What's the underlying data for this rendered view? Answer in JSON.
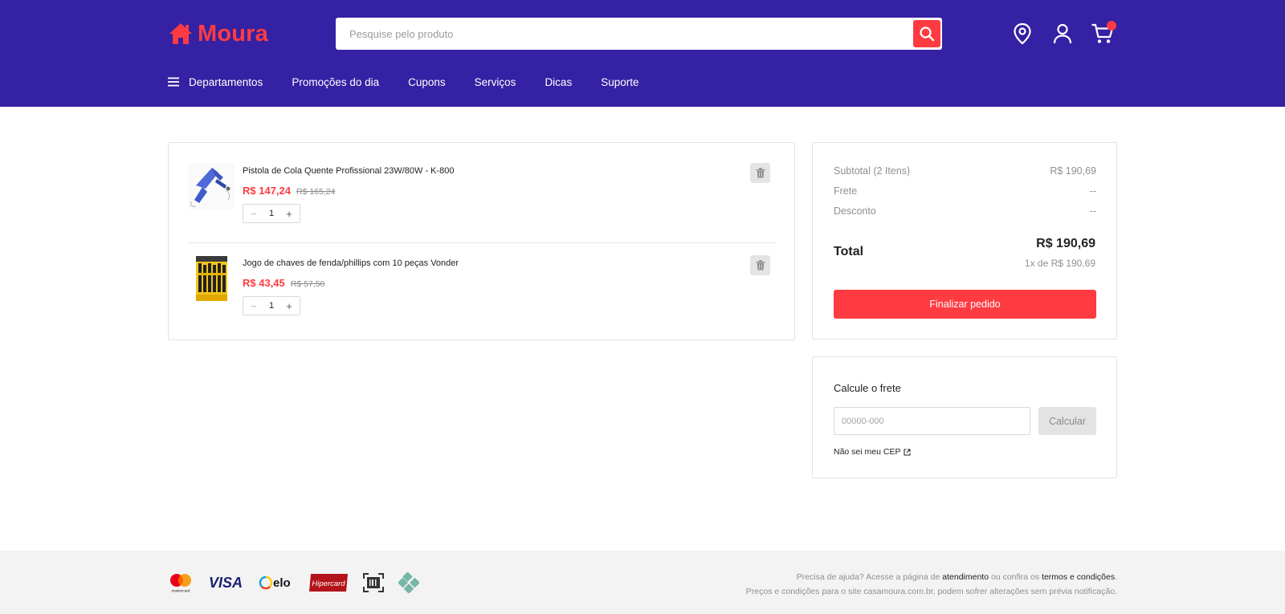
{
  "brand": {
    "name": "Moura",
    "accent": "#ff3b42",
    "header_bg": "#3421a3"
  },
  "search": {
    "placeholder": "Pesquise pelo produto"
  },
  "nav": {
    "departments": "Departamentos",
    "items": [
      "Promoções do dia",
      "Cupons",
      "Serviços",
      "Dicas",
      "Suporte"
    ]
  },
  "cart": {
    "items": [
      {
        "name": "Pistola de Cola Quente Profissional 23W/80W - K-800",
        "price": "R$ 147,24",
        "old_price": "R$ 165,24",
        "qty": "1",
        "icon": "glue-gun"
      },
      {
        "name": "Jogo de chaves de fenda/phillips com 10 peças Vonder",
        "price": "R$ 43,45",
        "old_price": "R$ 57,50",
        "qty": "1",
        "icon": "screwdriver-set"
      }
    ],
    "minus": "−",
    "plus": "+"
  },
  "summary": {
    "subtotal_label": "Subtotal (2 Itens)",
    "subtotal_value": "R$ 190,69",
    "shipping_label": "Frete",
    "shipping_value": "--",
    "discount_label": "Desconto",
    "discount_value": "--",
    "total_label": "Total",
    "total_value": "R$ 190,69",
    "installments": "1x de R$ 190,69",
    "checkout_label": "Finalizar pedido"
  },
  "shipping_calc": {
    "title": "Calcule o frete",
    "placeholder": "00000-000",
    "button": "Calcular",
    "link": "Não sei meu CEP"
  },
  "footer": {
    "payment_methods": [
      "mastercard",
      "VISA",
      "elo",
      "Hipercard",
      "boleto",
      "pix"
    ],
    "help_prefix": "Precisa de ajuda? Acesse a página de",
    "help_link": "atendimento",
    "help_middle": "ou confira os",
    "terms_link": "termos e condições",
    "help_suffix": ".",
    "notice": "Preços e condições para o site casamoura.com.br, podem sofrer alterações sem prévia notificação."
  }
}
